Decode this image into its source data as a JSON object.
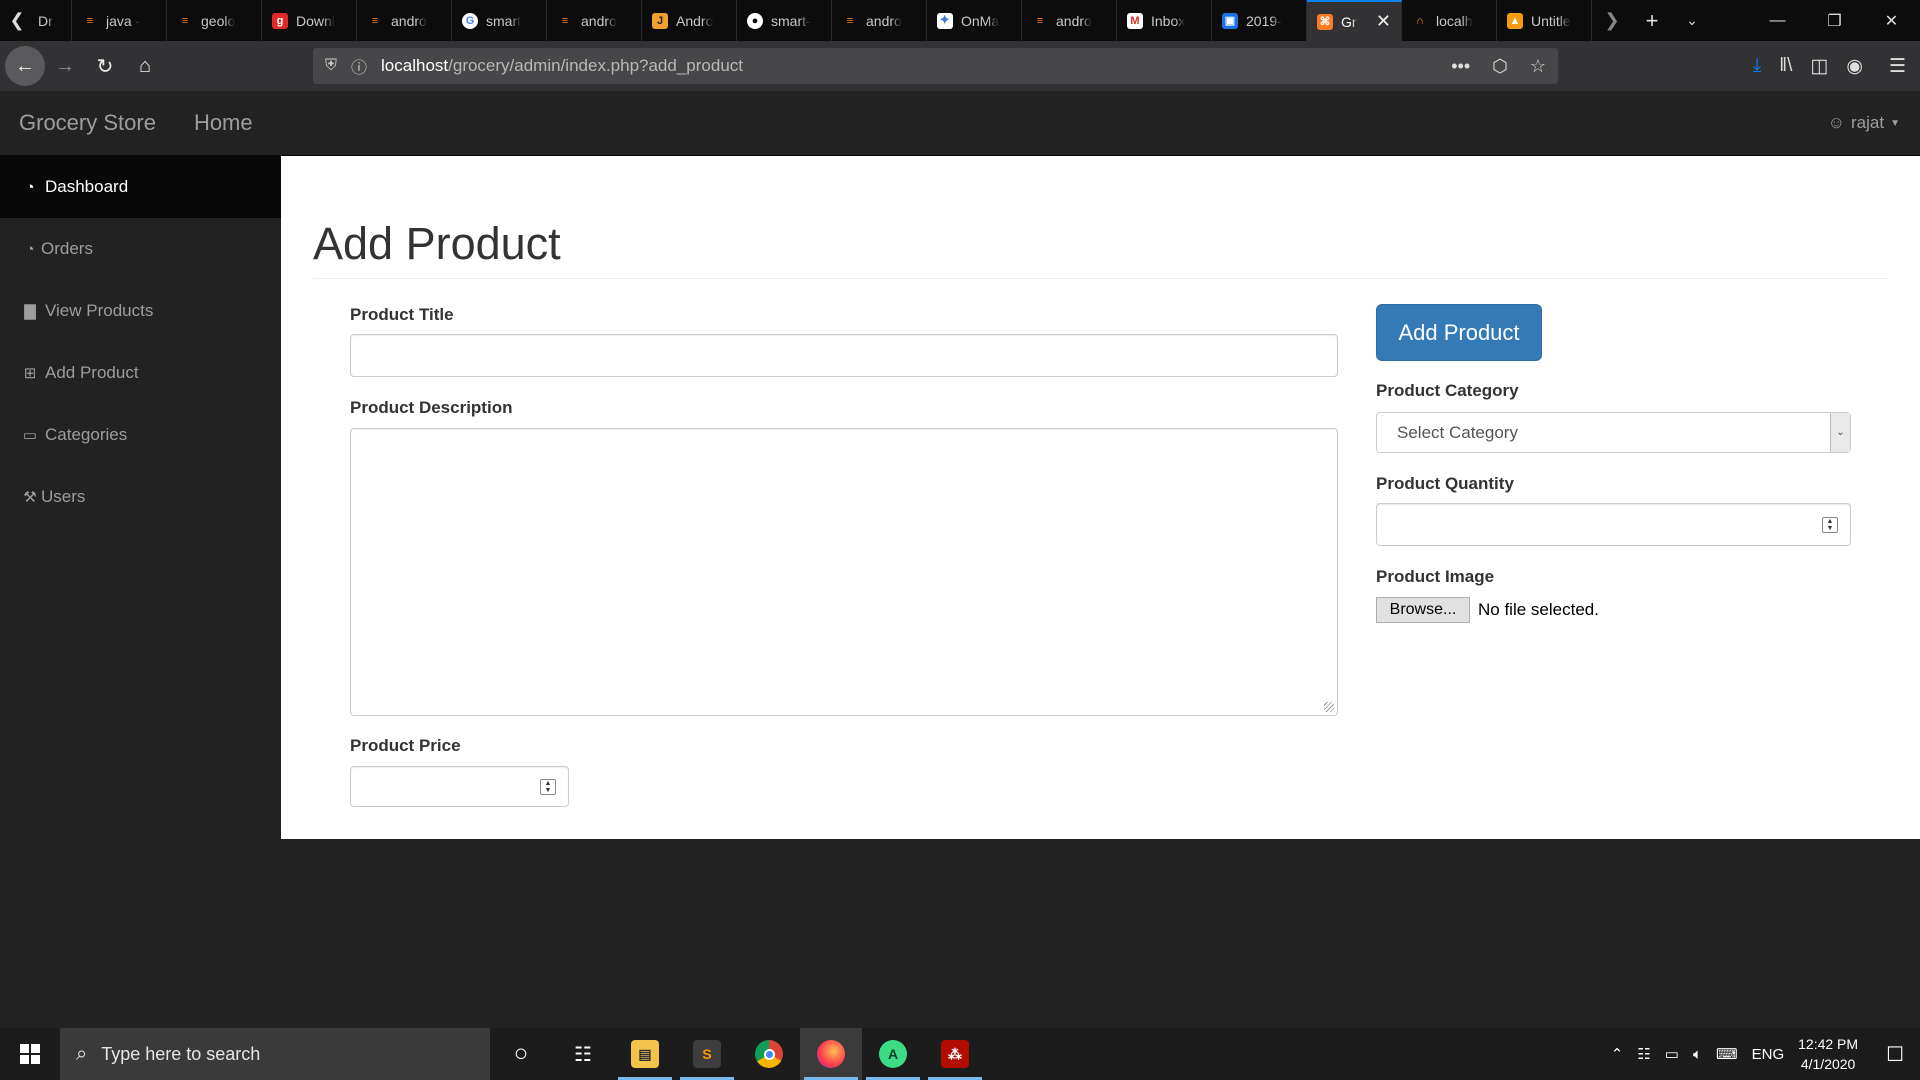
{
  "browser": {
    "tabs": [
      {
        "label": "Dr",
        "icon": "so-icon"
      },
      {
        "label": "java -",
        "icon": "so-icon"
      },
      {
        "label": "geolo",
        "icon": "so-icon"
      },
      {
        "label": "Downl",
        "icon": "gradle-icon"
      },
      {
        "label": "andro",
        "icon": "so-icon"
      },
      {
        "label": "smart",
        "icon": "google-icon"
      },
      {
        "label": "andro",
        "icon": "so-icon"
      },
      {
        "label": "Andro",
        "icon": "j-icon"
      },
      {
        "label": "smart-",
        "icon": "github-icon"
      },
      {
        "label": "andro",
        "icon": "so-icon"
      },
      {
        "label": "OnMa",
        "icon": "onmap-icon"
      },
      {
        "label": "andro",
        "icon": "so-icon"
      },
      {
        "label": "Inbox",
        "icon": "gmail-icon"
      },
      {
        "label": "2019-",
        "icon": "contacts-icon"
      },
      {
        "label": "Gr",
        "icon": "xampp-icon",
        "active": true
      },
      {
        "label": "localh",
        "icon": "pma-icon"
      },
      {
        "label": "Untitle",
        "icon": "untitled-icon"
      }
    ],
    "url_host": "localhost",
    "url_path": "/grocery/admin/index.php?add_product"
  },
  "navbar": {
    "brand": "Grocery Store",
    "home": "Home",
    "user": "rajat"
  },
  "sidebar": {
    "items": [
      {
        "label": "Dashboard",
        "icon": "dashboard-icon",
        "active": true
      },
      {
        "label": "Orders",
        "icon": "dashboard-icon"
      },
      {
        "label": "View Products",
        "icon": "bar-chart-icon"
      },
      {
        "label": "Add Product",
        "icon": "table-icon"
      },
      {
        "label": "Categories",
        "icon": "monitor-icon"
      },
      {
        "label": "Users",
        "icon": "wrench-icon"
      }
    ]
  },
  "page": {
    "title": "Add Product",
    "product_title_label": "Product Title",
    "product_description_label": "Product Description",
    "product_price_label": "Product Price",
    "submit_label": "Add Product",
    "category_label": "Product Category",
    "category_selected": "Select Category",
    "quantity_label": "Product Quantity",
    "image_label": "Product Image",
    "browse_label": "Browse...",
    "file_status": "No file selected."
  },
  "taskbar": {
    "search_placeholder": "Type here to search",
    "language": "ENG",
    "time": "12:42 PM",
    "date": "4/1/2020"
  },
  "colors": {
    "primary": "#337ab7",
    "sidebar_bg": "#222222",
    "active_bg": "#080808",
    "browser_accent": "#0a84ff"
  }
}
